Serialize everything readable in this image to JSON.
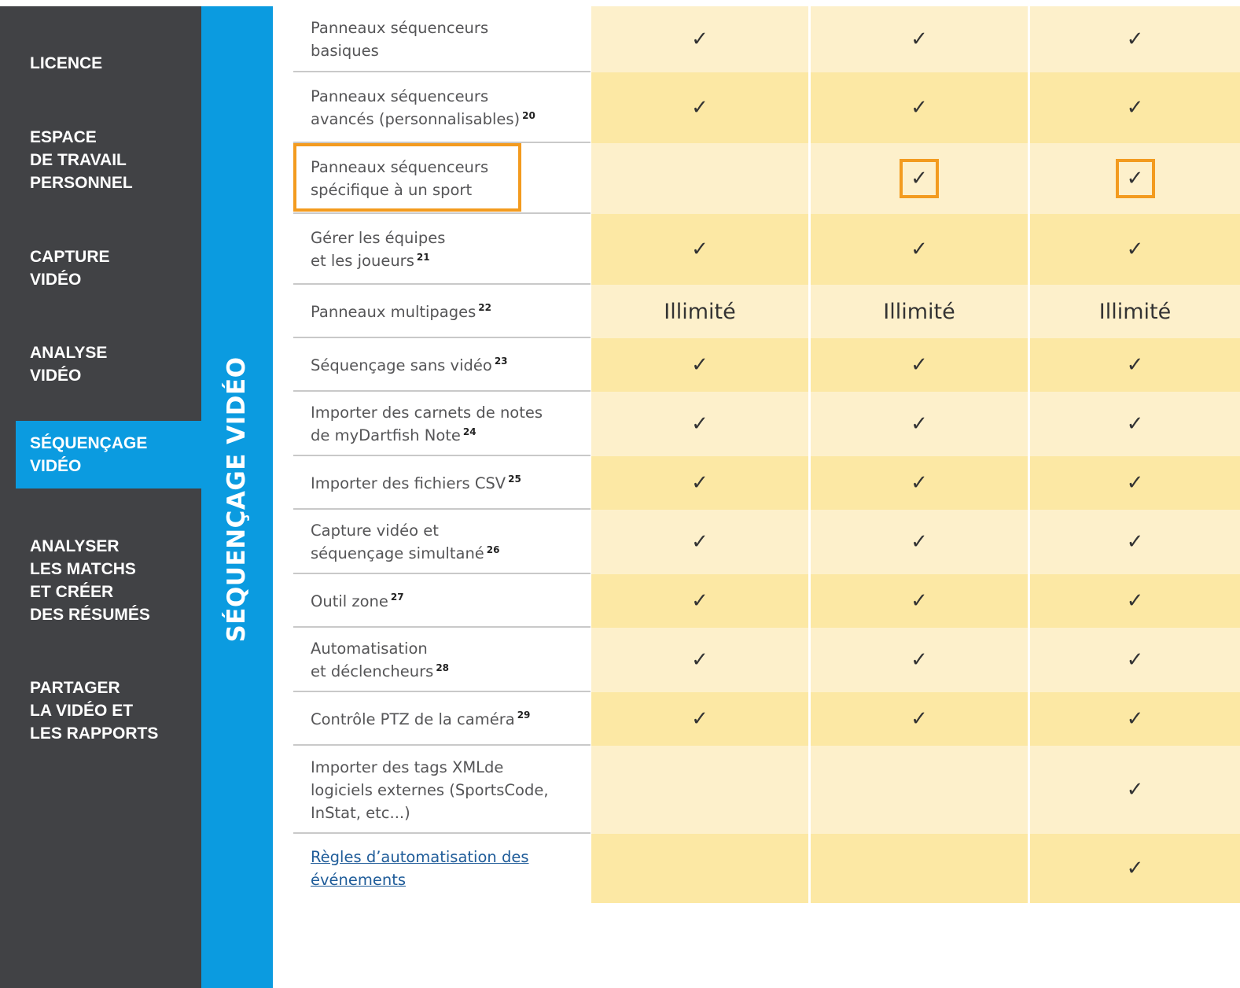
{
  "sidebar": {
    "items": [
      {
        "label": "LICENCE"
      },
      {
        "label": "ESPACE\nDE TRAVAIL\nPERSONNEL"
      },
      {
        "label": "CAPTURE\nVIDÉO"
      },
      {
        "label": "ANALYSE\nVIDÉO"
      },
      {
        "label": "SÉQUENÇAGE\nVIDÉO",
        "active": true
      },
      {
        "label": "ANALYSER\nLES MATCHS\nET CRÉER\nDES RÉSUMÉS"
      },
      {
        "label": "PARTAGER\nLA VIDÉO ET\nLES RAPPORTS"
      }
    ]
  },
  "section": {
    "title": "SÉQUENÇAGE VIDÉO"
  },
  "highlight_color": "#f39b1f",
  "rows": [
    {
      "label": "Panneaux séquenceurs\nbasiques",
      "note": "",
      "cells": [
        "check",
        "check",
        "check"
      ]
    },
    {
      "label": "Panneaux séquenceurs\navancés (personnalisables)",
      "note": "20",
      "cells": [
        "check",
        "check",
        "check"
      ]
    },
    {
      "label": "Panneaux séquenceurs\nspécifique à un sport",
      "note": "",
      "cells": [
        "",
        "check",
        "check"
      ],
      "highlighted": true
    },
    {
      "label": "Gérer les équipes\net les joueurs",
      "note": "21",
      "cells": [
        "check",
        "check",
        "check"
      ]
    },
    {
      "label": "Panneaux multipages",
      "note": "22",
      "cells": [
        "Illimité",
        "Illimité",
        "Illimité"
      ]
    },
    {
      "label": "Séquençage sans vidéo",
      "note": "23",
      "cells": [
        "check",
        "check",
        "check"
      ]
    },
    {
      "label": "Importer des carnets de notes\nde myDartfish Note",
      "note": "24",
      "cells": [
        "check",
        "check",
        "check"
      ]
    },
    {
      "label": "Importer des fichiers CSV",
      "note": "25",
      "cells": [
        "check",
        "check",
        "check"
      ]
    },
    {
      "label": "Capture vidéo et\nséquençage simultané",
      "note": "26",
      "cells": [
        "check",
        "check",
        "check"
      ]
    },
    {
      "label": "Outil zone",
      "note": "27",
      "cells": [
        "check",
        "check",
        "check"
      ]
    },
    {
      "label": "Automatisation\net déclencheurs",
      "note": "28",
      "cells": [
        "check",
        "check",
        "check"
      ]
    },
    {
      "label": "Contrôle PTZ de la caméra",
      "note": "29",
      "cells": [
        "check",
        "check",
        "check"
      ]
    },
    {
      "label": "Importer des  tags XMLde\nlogiciels externes (SportsCode,\nInStat, etc...)",
      "note": "",
      "cells": [
        "",
        "",
        "check"
      ]
    },
    {
      "label": "Règles d’automatisation des \névénements",
      "note": "",
      "cells": [
        "",
        "",
        "check"
      ],
      "link": true
    }
  ]
}
